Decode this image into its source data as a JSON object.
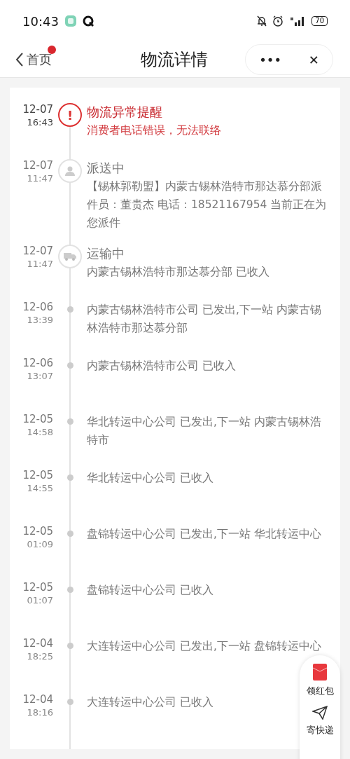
{
  "status_bar": {
    "time": "10:43",
    "battery": "70"
  },
  "header": {
    "back_label": "首页",
    "back_badge": true,
    "title": "物流详情",
    "more": "•••",
    "close": "✕"
  },
  "events": [
    {
      "kind": "alert",
      "mark": "!",
      "date": "12-07",
      "time": "16:43",
      "title": "物流异常提醒",
      "description": "消费者电话错误，无法联络"
    },
    {
      "kind": "person",
      "date": "12-07",
      "time": "11:47",
      "title": "派送中",
      "description": "【锡林郭勒盟】内蒙古锡林浩特市那达慕分部派件员：董贵杰 电话：18521167954 当前正在为您派件"
    },
    {
      "kind": "truck",
      "date": "12-07",
      "time": "11:47",
      "title": "运输中",
      "description": "内蒙古锡林浩特市那达慕分部 已收入"
    },
    {
      "kind": "dot",
      "date": "12-06",
      "time": "13:39",
      "description": "内蒙古锡林浩特市公司 已发出,下一站 内蒙古锡林浩特市那达慕分部"
    },
    {
      "kind": "dot",
      "date": "12-06",
      "time": "13:07",
      "description": "内蒙古锡林浩特市公司 已收入"
    },
    {
      "kind": "dot",
      "date": "12-05",
      "time": "14:58",
      "description": "华北转运中心公司 已发出,下一站 内蒙古锡林浩特市"
    },
    {
      "kind": "dot",
      "date": "12-05",
      "time": "14:55",
      "description": "华北转运中心公司 已收入"
    },
    {
      "kind": "dot",
      "date": "12-05",
      "time": "01:09",
      "description": "盘锦转运中心公司 已发出,下一站 华北转运中心"
    },
    {
      "kind": "dot",
      "date": "12-05",
      "time": "01:07",
      "description": "盘锦转运中心公司 已收入"
    },
    {
      "kind": "dot",
      "date": "12-04",
      "time": "18:25",
      "description": "大连转运中心公司 已发出,下一站 盘锦转运中心"
    },
    {
      "kind": "dot",
      "date": "12-04",
      "time": "18:16",
      "description": "大连转运中心公司 已收入"
    }
  ],
  "floating_actions": [
    {
      "kind": "redpacket",
      "label": "领红包"
    },
    {
      "kind": "send",
      "label": "寄快递"
    }
  ]
}
